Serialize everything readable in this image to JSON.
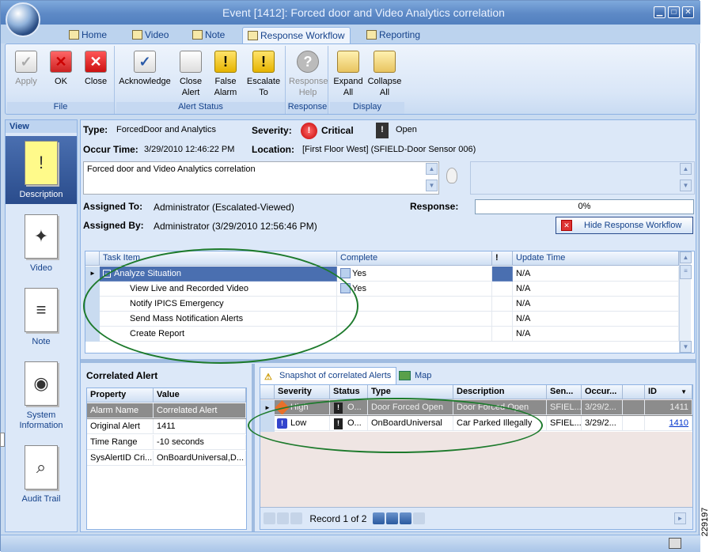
{
  "window": {
    "title": "Event [1412]: Forced door and Video Analytics correlation",
    "minimize": "▁",
    "maximize": "□",
    "close": "✕"
  },
  "tabs": [
    {
      "label": "Home"
    },
    {
      "label": "Video"
    },
    {
      "label": "Note"
    },
    {
      "label": "Response Workflow"
    },
    {
      "label": "Reporting"
    }
  ],
  "ribbon": {
    "groups": [
      {
        "label": "File"
      },
      {
        "label": "Alert Status"
      },
      {
        "label": "Response"
      },
      {
        "label": "Display"
      }
    ],
    "apply": {
      "line1": "Apply",
      "line2": ""
    },
    "ok": {
      "line1": "OK",
      "line2": ""
    },
    "close": {
      "line1": "Close",
      "line2": ""
    },
    "acknowledge": {
      "line1": "Acknowledge",
      "line2": ""
    },
    "close_alert": {
      "line1": "Close",
      "line2": "Alert"
    },
    "false_alarm": {
      "line1": "False",
      "line2": "Alarm"
    },
    "escalate": {
      "line1": "Escalate",
      "line2": "To"
    },
    "response_help": {
      "line1": "Response",
      "line2": "Help"
    },
    "expand_all": {
      "line1": "Expand",
      "line2": "All"
    },
    "collapse_all": {
      "line1": "Collapse",
      "line2": "All"
    }
  },
  "sidebar": {
    "header": "View",
    "items": [
      {
        "line1": "Description",
        "line2": ""
      },
      {
        "line1": "Video",
        "line2": ""
      },
      {
        "line1": "Note",
        "line2": ""
      },
      {
        "line1": "System",
        "line2": "Information"
      },
      {
        "line1": "Audit Trail",
        "line2": ""
      }
    ]
  },
  "details": {
    "type_label": "Type:",
    "type_value": "ForcedDoor and Analytics",
    "severity_label": "Severity:",
    "severity_value": "Critical",
    "status_value": "Open",
    "occur_label": "Occur Time:",
    "occur_value": "3/29/2010 12:46:22 PM",
    "location_label": "Location:",
    "location_value": "[First Floor West] (SFIELD-Door Sensor 006)",
    "description": "Forced door and Video Analytics correlation",
    "assigned_to_label": "Assigned To:",
    "assigned_to_value": "Administrator (Escalated-Viewed)",
    "assigned_by_label": "Assigned By:",
    "assigned_by_value": "Administrator (3/29/2010 12:56:46 PM)",
    "response_label": "Response:",
    "response_value": "0%",
    "response_fraction": 0,
    "hide_button": "Hide Response Workflow"
  },
  "tasks": {
    "columns": [
      "Task Item",
      "Complete",
      "!",
      "Update Time"
    ],
    "rows": [
      {
        "item": "Analyze Situation",
        "complete": "Yes",
        "update": "N/A"
      },
      {
        "item": "View Live and Recorded Video",
        "complete": "Yes",
        "update": "N/A"
      },
      {
        "item": "Notify IPICS Emergency",
        "complete": "",
        "update": "N/A"
      },
      {
        "item": "Send Mass Notification Alerts",
        "complete": "",
        "update": "N/A"
      },
      {
        "item": "Create Report",
        "complete": "",
        "update": "N/A"
      }
    ]
  },
  "correlated": {
    "title": "Correlated Alert",
    "columns": [
      "Property",
      "Value"
    ],
    "rows": [
      {
        "p": "Alarm Name",
        "v": "Correlated Alert"
      },
      {
        "p": "Original Alert",
        "v": "1411"
      },
      {
        "p": "Time Range",
        "v": "-10 seconds"
      },
      {
        "p": "SysAlertID Cri...",
        "v": "OnBoardUniversal,D..."
      }
    ]
  },
  "snapshot": {
    "tab1": "Snapshot of correlated Alerts",
    "tab2": "Map",
    "columns": [
      "Severity",
      "Status",
      "Type",
      "Description",
      "Sen...",
      "Occur...",
      "",
      "ID"
    ],
    "rows": [
      {
        "severity": "High",
        "status": "O...",
        "type": "Door Forced Open",
        "desc": "Door Forced Open",
        "sensor": "SFIEL...",
        "occur": "3/29/2...",
        "id": "1411"
      },
      {
        "severity": "Low",
        "status": "O...",
        "type": "OnBoardUniversal",
        "desc": "Car Parked Illegally",
        "sensor": "SFIEL...",
        "occur": "3/29/2...",
        "id": "1410"
      }
    ],
    "pager": "Record 1 of 2"
  },
  "figure_id": "229197"
}
